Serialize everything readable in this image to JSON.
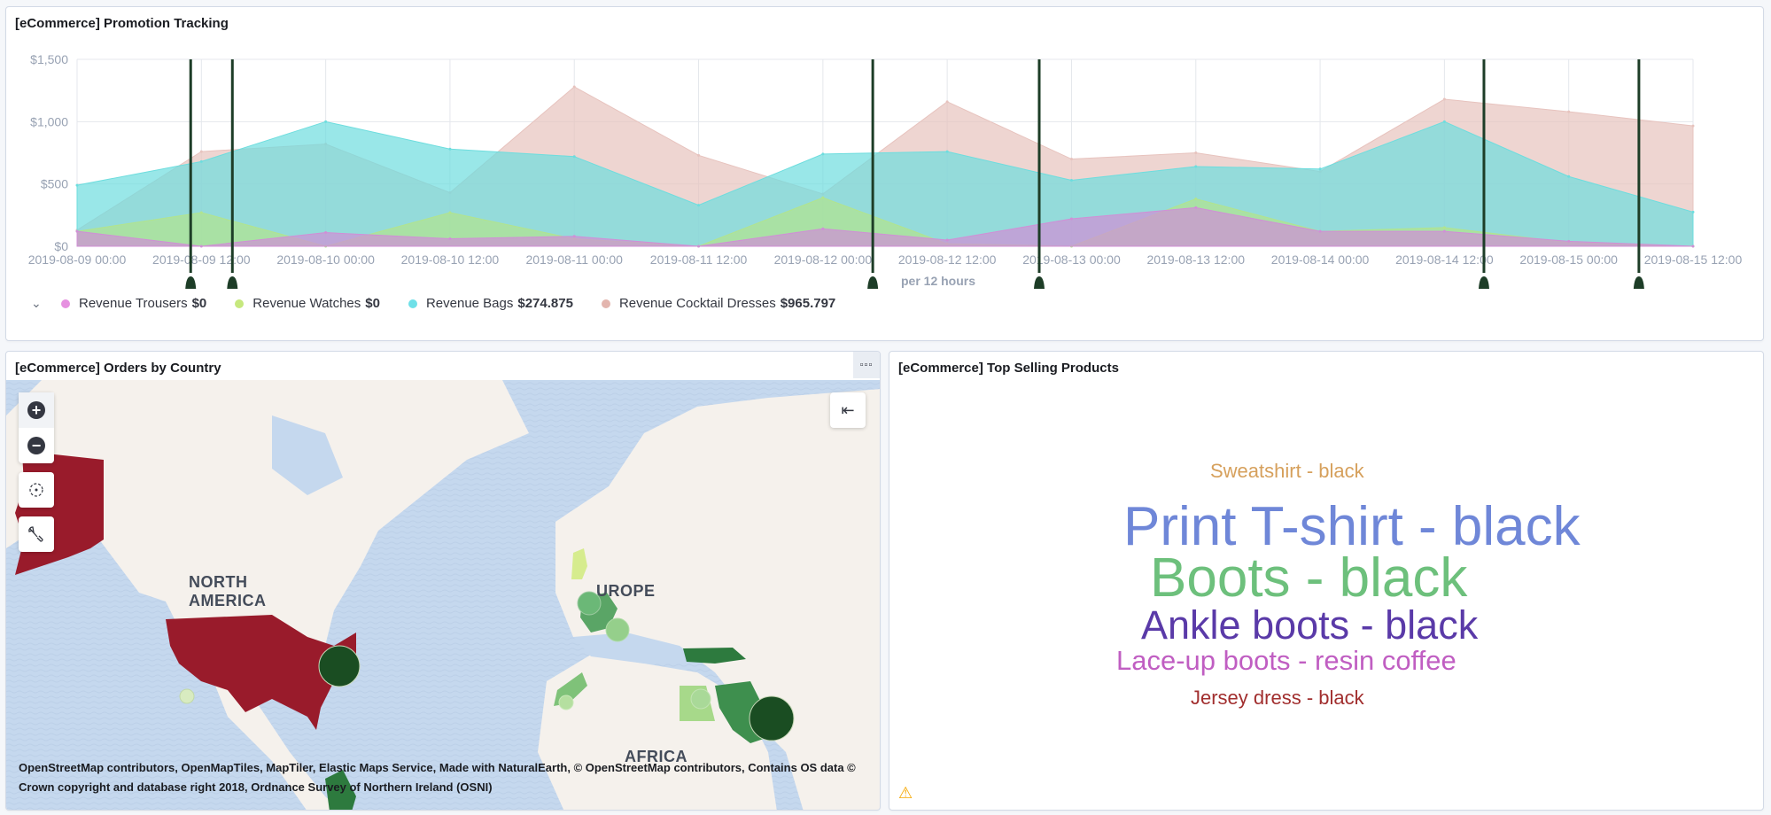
{
  "panels": {
    "promotion": {
      "title": "[eCommerce] Promotion Tracking"
    },
    "orders_map": {
      "title": "[eCommerce] Orders by Country"
    },
    "top_products": {
      "title": "[eCommerce] Top Selling Products"
    }
  },
  "chart_data": {
    "type": "area",
    "title": "[eCommerce] Promotion Tracking",
    "xlabel": "per 12 hours",
    "ylabel": "",
    "ylim": [
      0,
      1500
    ],
    "yticks": [
      "$0",
      "$500",
      "$1,000",
      "$1,500"
    ],
    "ytick_values": [
      0,
      500,
      1000,
      1500
    ],
    "grid": true,
    "stacked": false,
    "legend_position": "bottom-left",
    "x": [
      "2019-08-09 00:00",
      "2019-08-09 12:00",
      "2019-08-10 00:00",
      "2019-08-10 12:00",
      "2019-08-11 00:00",
      "2019-08-11 12:00",
      "2019-08-12 00:00",
      "2019-08-12 12:00",
      "2019-08-13 00:00",
      "2019-08-13 12:00",
      "2019-08-14 00:00",
      "2019-08-14 12:00",
      "2019-08-15 00:00",
      "2019-08-15 12:00"
    ],
    "series": [
      {
        "name": "Revenue Cocktail Dresses",
        "legend_value": "$965.797",
        "color": "#e7c3be",
        "values": [
          130,
          760,
          820,
          430,
          1280,
          730,
          420,
          1160,
          700,
          750,
          600,
          1180,
          1080,
          966
        ]
      },
      {
        "name": "Revenue Bags",
        "legend_value": "$274.875",
        "color": "#6dddde",
        "values": [
          490,
          680,
          1000,
          780,
          720,
          330,
          740,
          760,
          530,
          640,
          620,
          1000,
          560,
          275
        ]
      },
      {
        "name": "Revenue Watches",
        "legend_value": "$0",
        "color": "#b2e48d",
        "values": [
          120,
          270,
          0,
          270,
          60,
          0,
          390,
          20,
          0,
          380,
          120,
          150,
          30,
          0
        ]
      },
      {
        "name": "Revenue Trousers",
        "legend_value": "$0",
        "color": "#d08fd6",
        "values": [
          120,
          0,
          110,
          60,
          80,
          0,
          140,
          50,
          220,
          310,
          120,
          120,
          40,
          0
        ]
      }
    ],
    "annotations": [
      {
        "label": "annotation-1",
        "x_fraction": 0.0703
      },
      {
        "label": "annotation-2",
        "x_fraction": 0.0961
      },
      {
        "label": "annotation-3",
        "x_fraction": 0.4924
      },
      {
        "label": "annotation-4",
        "x_fraction": 0.5954
      },
      {
        "label": "annotation-5",
        "x_fraction": 0.8706
      },
      {
        "label": "annotation-6",
        "x_fraction": 0.9665
      }
    ]
  },
  "legend": {
    "collapse_icon": "chevron-down-icon",
    "items": [
      {
        "label": "Revenue Trousers",
        "value": "$0",
        "color": "#e690e0"
      },
      {
        "label": "Revenue Watches",
        "value": "$0",
        "color": "#c6e87e"
      },
      {
        "label": "Revenue Bags",
        "value": "$274.875",
        "color": "#6ee0e8"
      },
      {
        "label": "Revenue Cocktail Dresses",
        "value": "$965.797",
        "color": "#e3b5ae"
      }
    ]
  },
  "map": {
    "options_icon": "ellipsis-icon",
    "controls": {
      "zoom_in": "+",
      "zoom_out": "−"
    },
    "labels": {
      "north_america": "NORTH AMERICA",
      "europe": "EUROPE",
      "africa": "AFRICA"
    },
    "attribution": "OpenStreetMap contributors, OpenMapTiles, MapTiler, Elastic Maps Service, Made with NaturalEarth, © OpenStreetMap contributors, Contains OS data © Crown copyright and database right 2018, Ordnance Survey of Northern Ireland (OSNI)",
    "colors": {
      "water": "#c5d8ee",
      "land": "#f5f1ec",
      "usa": "#991b2b",
      "green_dark": "#1d4e27",
      "green_mid": "#3e8f4e",
      "green_light": "#a7d98a"
    }
  },
  "word_cloud": {
    "words": [
      {
        "text": "Sweatshirt - black",
        "color": "#d6a05c"
      },
      {
        "text": "Print T-shirt - black",
        "color": "#6f87d8"
      },
      {
        "text": "Boots - black",
        "color": "#6dc07c"
      },
      {
        "text": "Ankle boots - black",
        "color": "#5a3aa8"
      },
      {
        "text": "Lace-up boots - resin coffee",
        "color": "#c05ec2"
      },
      {
        "text": "Jersey dress - black",
        "color": "#a12e2e"
      }
    ],
    "warning_icon": "warning-icon"
  }
}
